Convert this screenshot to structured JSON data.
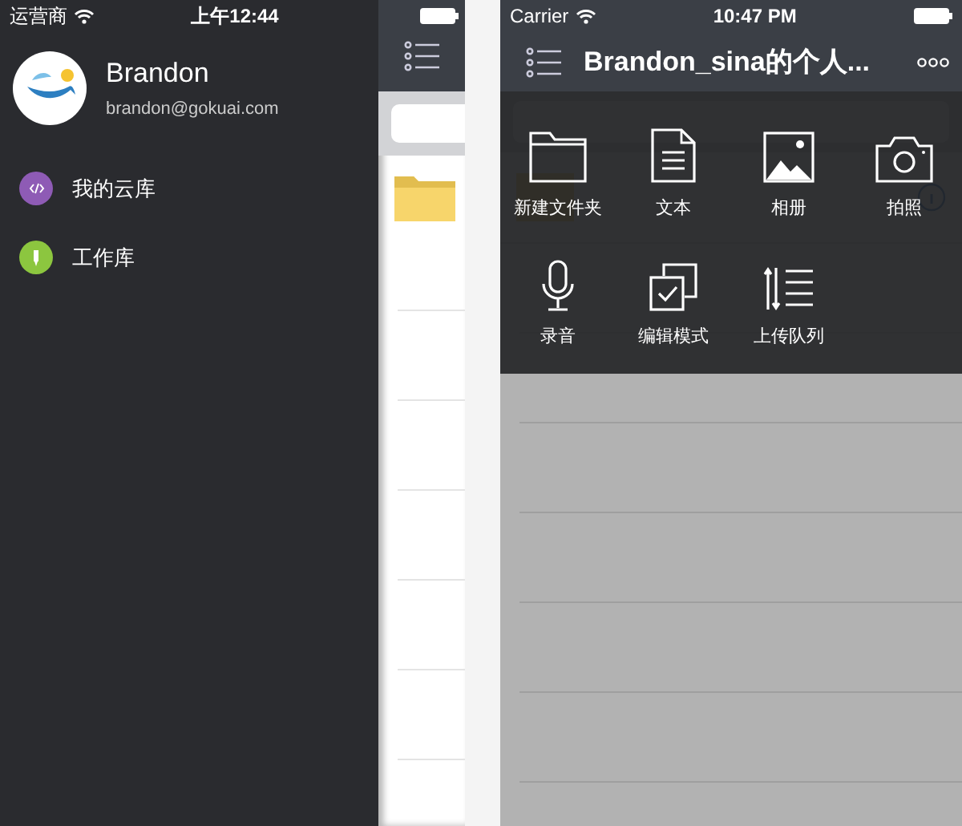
{
  "left_phone": {
    "status_bar": {
      "carrier": "运营商",
      "time": "上午12:44"
    },
    "profile": {
      "name": "Brandon",
      "email": "brandon@gokuai.com"
    },
    "menu": [
      {
        "label": "我的云库",
        "color": "#8e5bb5",
        "kind": "code"
      },
      {
        "label": "工作库",
        "color": "#8cc63f",
        "kind": "tool"
      }
    ]
  },
  "right_phone": {
    "status_bar": {
      "carrier": "Carrier",
      "time": "10:47 PM"
    },
    "nav_title": "Brandon_sina的个人...",
    "actions": [
      {
        "label": "新建文件夹",
        "kind": "folder"
      },
      {
        "label": "文本",
        "kind": "text"
      },
      {
        "label": "相册",
        "kind": "photo"
      },
      {
        "label": "拍照",
        "kind": "camera"
      },
      {
        "label": "录音",
        "kind": "mic"
      },
      {
        "label": "编辑模式",
        "kind": "edit"
      },
      {
        "label": "上传队列",
        "kind": "upload"
      }
    ]
  }
}
